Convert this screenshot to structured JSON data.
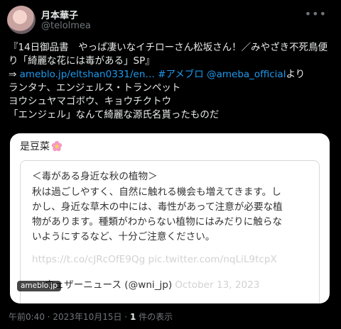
{
  "author": {
    "display_name": "月本華子",
    "handle": "@telolmea"
  },
  "tweet": {
    "lines": [
      "『14日御品書　やっぱ凄いなイチローさん松坂さん！／みやざき不死鳥便",
      "り「綺麗な花には毒がある」SP』"
    ],
    "share_prefix": "⇒ ",
    "link_url": "ameblo.jp/eltshan0331/en…",
    "hashtag": "#アメブロ",
    "mention": "@ameba_official",
    "share_suffix": "より",
    "body_lines": [
      "ランタナ、エンジェルス・トランペット",
      "ヨウシュヤマゴボウ、キョウチクトウ",
      "「エンジェル」なんて綺麗な源氏名貰ったものだ"
    ]
  },
  "card": {
    "title": "是豆菜",
    "embed_heading": "＜毒がある身近な秋の植物＞",
    "embed_lines": [
      "秋は過ごしやすく、自然に触れる機会も増えてきます。し",
      "かし、身近な草木の中には、毒性があって注意が必要な植",
      "物があります。種類がわからない植物にはみだりに触らな",
      "いようにするなど、十分ご注意ください。"
    ],
    "embed_url": "https://t.co/cJRcOfE9Qg pic.twitter.com/nqLiL9tcpX",
    "embed_source": "— ウェザーニュース (@wni_jp)",
    "embed_date": "October 13, 2023",
    "domain": "ameblo.jp"
  },
  "meta": {
    "timestamp": "午前0:40 · 2023年10月15日",
    "separator": " · ",
    "views_count": "1",
    "views_label": " 件の表示"
  },
  "colors": {
    "background": "#000000",
    "text": "#e7e9ea",
    "link": "#1d9bf0",
    "muted": "#71767b"
  }
}
